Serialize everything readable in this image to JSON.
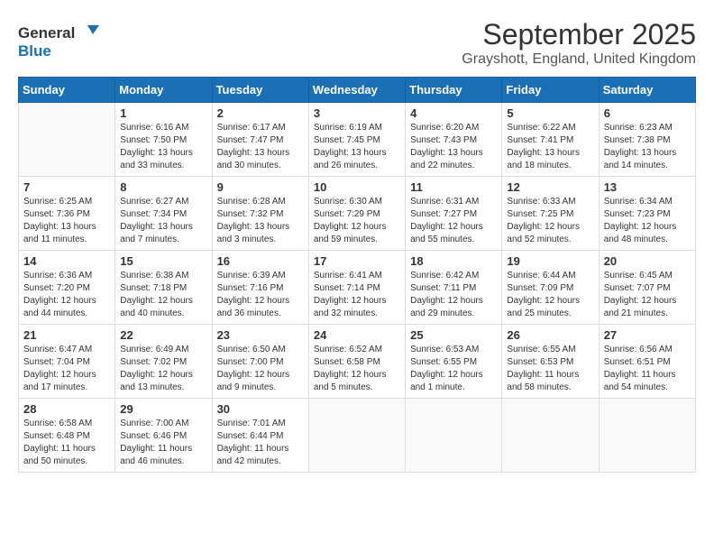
{
  "logo": {
    "text_general": "General",
    "text_blue": "Blue"
  },
  "header": {
    "month": "September 2025",
    "location": "Grayshott, England, United Kingdom"
  },
  "weekdays": [
    "Sunday",
    "Monday",
    "Tuesday",
    "Wednesday",
    "Thursday",
    "Friday",
    "Saturday"
  ],
  "days": [
    {
      "num": "",
      "info": ""
    },
    {
      "num": "1",
      "info": "Sunrise: 6:16 AM\nSunset: 7:50 PM\nDaylight: 13 hours\nand 33 minutes."
    },
    {
      "num": "2",
      "info": "Sunrise: 6:17 AM\nSunset: 7:47 PM\nDaylight: 13 hours\nand 30 minutes."
    },
    {
      "num": "3",
      "info": "Sunrise: 6:19 AM\nSunset: 7:45 PM\nDaylight: 13 hours\nand 26 minutes."
    },
    {
      "num": "4",
      "info": "Sunrise: 6:20 AM\nSunset: 7:43 PM\nDaylight: 13 hours\nand 22 minutes."
    },
    {
      "num": "5",
      "info": "Sunrise: 6:22 AM\nSunset: 7:41 PM\nDaylight: 13 hours\nand 18 minutes."
    },
    {
      "num": "6",
      "info": "Sunrise: 6:23 AM\nSunset: 7:38 PM\nDaylight: 13 hours\nand 14 minutes."
    },
    {
      "num": "7",
      "info": "Sunrise: 6:25 AM\nSunset: 7:36 PM\nDaylight: 13 hours\nand 11 minutes."
    },
    {
      "num": "8",
      "info": "Sunrise: 6:27 AM\nSunset: 7:34 PM\nDaylight: 13 hours\nand 7 minutes."
    },
    {
      "num": "9",
      "info": "Sunrise: 6:28 AM\nSunset: 7:32 PM\nDaylight: 13 hours\nand 3 minutes."
    },
    {
      "num": "10",
      "info": "Sunrise: 6:30 AM\nSunset: 7:29 PM\nDaylight: 12 hours\nand 59 minutes."
    },
    {
      "num": "11",
      "info": "Sunrise: 6:31 AM\nSunset: 7:27 PM\nDaylight: 12 hours\nand 55 minutes."
    },
    {
      "num": "12",
      "info": "Sunrise: 6:33 AM\nSunset: 7:25 PM\nDaylight: 12 hours\nand 52 minutes."
    },
    {
      "num": "13",
      "info": "Sunrise: 6:34 AM\nSunset: 7:23 PM\nDaylight: 12 hours\nand 48 minutes."
    },
    {
      "num": "14",
      "info": "Sunrise: 6:36 AM\nSunset: 7:20 PM\nDaylight: 12 hours\nand 44 minutes."
    },
    {
      "num": "15",
      "info": "Sunrise: 6:38 AM\nSunset: 7:18 PM\nDaylight: 12 hours\nand 40 minutes."
    },
    {
      "num": "16",
      "info": "Sunrise: 6:39 AM\nSunset: 7:16 PM\nDaylight: 12 hours\nand 36 minutes."
    },
    {
      "num": "17",
      "info": "Sunrise: 6:41 AM\nSunset: 7:14 PM\nDaylight: 12 hours\nand 32 minutes."
    },
    {
      "num": "18",
      "info": "Sunrise: 6:42 AM\nSunset: 7:11 PM\nDaylight: 12 hours\nand 29 minutes."
    },
    {
      "num": "19",
      "info": "Sunrise: 6:44 AM\nSunset: 7:09 PM\nDaylight: 12 hours\nand 25 minutes."
    },
    {
      "num": "20",
      "info": "Sunrise: 6:45 AM\nSunset: 7:07 PM\nDaylight: 12 hours\nand 21 minutes."
    },
    {
      "num": "21",
      "info": "Sunrise: 6:47 AM\nSunset: 7:04 PM\nDaylight: 12 hours\nand 17 minutes."
    },
    {
      "num": "22",
      "info": "Sunrise: 6:49 AM\nSunset: 7:02 PM\nDaylight: 12 hours\nand 13 minutes."
    },
    {
      "num": "23",
      "info": "Sunrise: 6:50 AM\nSunset: 7:00 PM\nDaylight: 12 hours\nand 9 minutes."
    },
    {
      "num": "24",
      "info": "Sunrise: 6:52 AM\nSunset: 6:58 PM\nDaylight: 12 hours\nand 5 minutes."
    },
    {
      "num": "25",
      "info": "Sunrise: 6:53 AM\nSunset: 6:55 PM\nDaylight: 12 hours\nand 1 minute."
    },
    {
      "num": "26",
      "info": "Sunrise: 6:55 AM\nSunset: 6:53 PM\nDaylight: 11 hours\nand 58 minutes."
    },
    {
      "num": "27",
      "info": "Sunrise: 6:56 AM\nSunset: 6:51 PM\nDaylight: 11 hours\nand 54 minutes."
    },
    {
      "num": "28",
      "info": "Sunrise: 6:58 AM\nSunset: 6:48 PM\nDaylight: 11 hours\nand 50 minutes."
    },
    {
      "num": "29",
      "info": "Sunrise: 7:00 AM\nSunset: 6:46 PM\nDaylight: 11 hours\nand 46 minutes."
    },
    {
      "num": "30",
      "info": "Sunrise: 7:01 AM\nSunset: 6:44 PM\nDaylight: 11 hours\nand 42 minutes."
    },
    {
      "num": "",
      "info": ""
    },
    {
      "num": "",
      "info": ""
    },
    {
      "num": "",
      "info": ""
    },
    {
      "num": "",
      "info": ""
    }
  ]
}
